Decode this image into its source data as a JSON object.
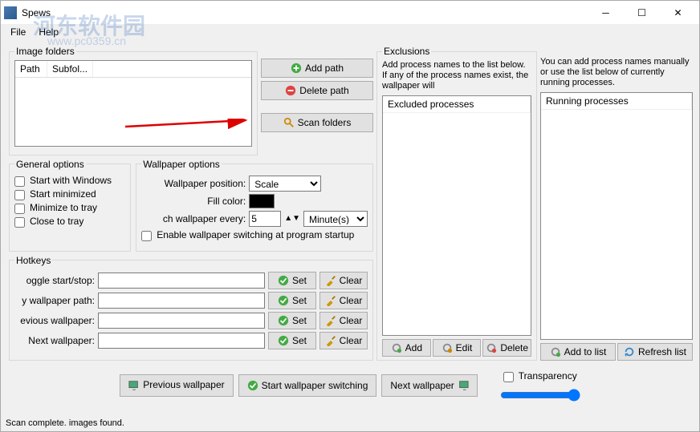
{
  "window": {
    "title": "Spews"
  },
  "menu": {
    "file": "File",
    "help": "Help"
  },
  "watermark": {
    "main": "河东软件园",
    "sub": "www.pc0359.cn"
  },
  "imageFolders": {
    "legend": "Image folders",
    "cols": {
      "path": "Path",
      "subfolders": "Subfol..."
    }
  },
  "buttons": {
    "addPath": "Add path",
    "deletePath": "Delete path",
    "scanFolders": "Scan folders",
    "set": "Set",
    "clear": "Clear",
    "add": "Add",
    "edit": "Edit",
    "delete": "Delete",
    "addToList": "Add to list",
    "refreshList": "Refresh list",
    "prevWall": "Previous wallpaper",
    "startSwitch": "Start wallpaper switching",
    "nextWall": "Next wallpaper"
  },
  "general": {
    "legend": "General options",
    "startWin": "Start with Windows",
    "startMin": "Start minimized",
    "minTray": "Minimize to tray",
    "closeTray": "Close to tray"
  },
  "wallpaper": {
    "legend": "Wallpaper options",
    "position": "Wallpaper position:",
    "positionVal": "Scale",
    "fill": "Fill color:",
    "change": "ch wallpaper every:",
    "changeVal": "5",
    "unitVal": "Minute(s)",
    "enable": "Enable wallpaper switching at program startup"
  },
  "hotkeys": {
    "legend": "Hotkeys",
    "toggle": "oggle start/stop:",
    "copy": "y wallpaper path:",
    "prev": "evious wallpaper:",
    "next": "Next wallpaper:"
  },
  "exclusions": {
    "legend": "Exclusions",
    "desc1": "Add process names to the list below.  If any of the process names exist, the wallpaper will",
    "header1": "Excluded processes",
    "desc2": "You can add process names manually or use the list below of currently running processes.",
    "header2": "Running processes"
  },
  "transparency": "Transparency",
  "status": "Scan complete.   images found."
}
